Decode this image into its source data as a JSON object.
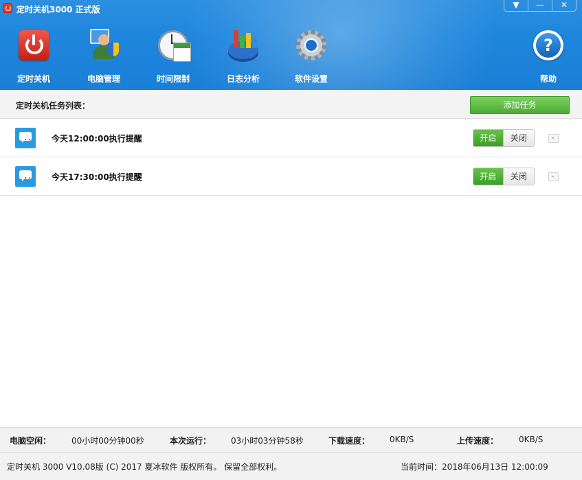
{
  "window": {
    "title": "定时关机3000 正式版",
    "buttons": [
      "▼",
      "—",
      "✕"
    ]
  },
  "toolbar": {
    "items": [
      {
        "label": "定时关机",
        "icon": "power-icon"
      },
      {
        "label": "电脑管理",
        "icon": "user-shield-icon"
      },
      {
        "label": "时间限制",
        "icon": "clock-calendar-icon"
      },
      {
        "label": "日志分析",
        "icon": "chart-icon"
      },
      {
        "label": "软件设置",
        "icon": "gear-icon"
      }
    ],
    "help": {
      "label": "帮助",
      "icon": "help-icon",
      "glyph": "?"
    }
  },
  "list": {
    "title": "定时关机任务列表：",
    "add_button": "添加任务",
    "rows": [
      {
        "text": "今天12:00:00执行提醒",
        "on": "开启",
        "off": "关闭",
        "state": "on",
        "icon": "message-icon"
      },
      {
        "text": "今天17:30:00执行提醒",
        "on": "开启",
        "off": "关闭",
        "state": "on",
        "icon": "message-icon"
      }
    ]
  },
  "stats": {
    "idle_label": "电脑空闲：",
    "idle_value": "00小时00分钟00秒",
    "run_label": "本次运行：",
    "run_value": "03小时03分钟58秒",
    "down_label": "下载速度：",
    "down_value": "0KB/S",
    "up_label": "上传速度：",
    "up_value": "0KB/S"
  },
  "footer": {
    "copyright": "定时关机 3000 V10.08版 (C) 2017  夏冰软件 版权所有。 保留全部权利。",
    "current_time": "当前时间：2018年06月13日 12:00:09"
  },
  "colors": {
    "header": "#1f86dd",
    "accent_green": "#4cad34",
    "message_blue": "#2a9be0"
  }
}
